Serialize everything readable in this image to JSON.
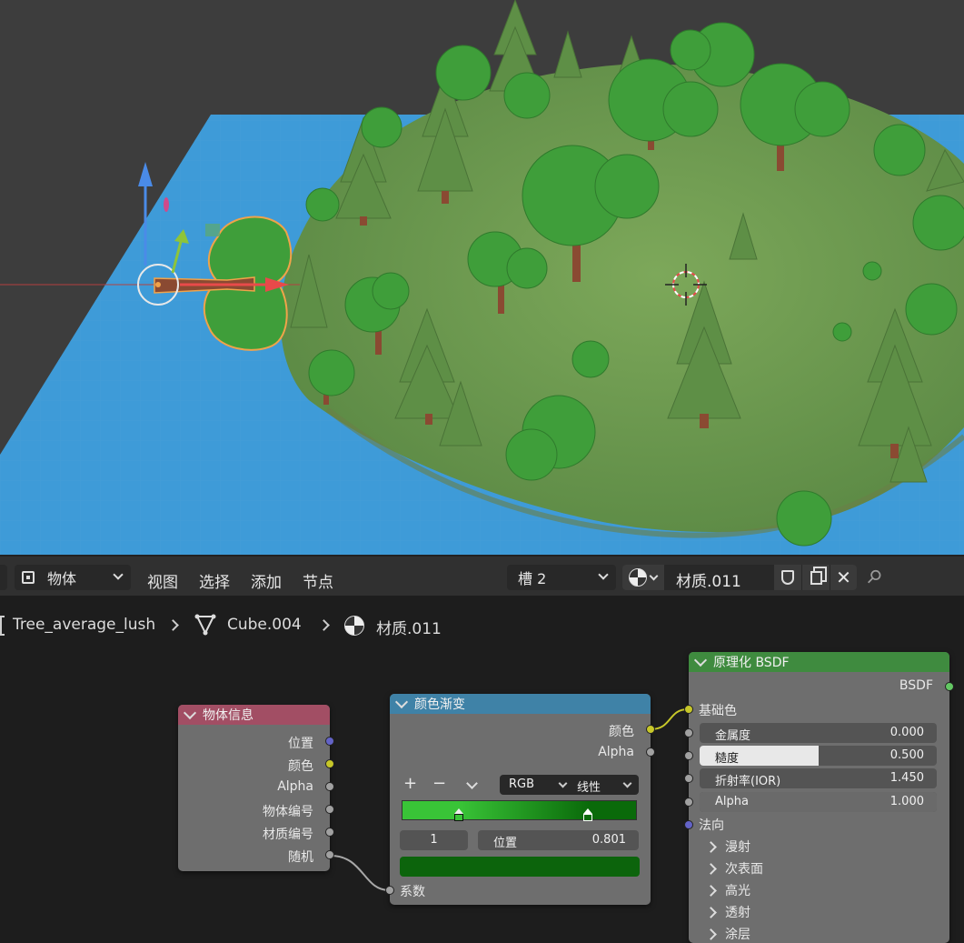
{
  "header": {
    "mode_label": "物体",
    "menu": [
      "视图",
      "选择",
      "添加",
      "节点"
    ],
    "slot_label": "槽 2",
    "material_name": "材质.011"
  },
  "breadcrumb": {
    "object": "Tree_average_lush",
    "mesh": "Cube.004",
    "material": "材质.011"
  },
  "nodes": {
    "object_info": {
      "title": "物体信息",
      "outputs": [
        "位置",
        "颜色",
        "Alpha",
        "物体编号",
        "材质编号",
        "随机"
      ]
    },
    "color_ramp": {
      "title": "颜色渐变",
      "outputs": [
        "颜色",
        "Alpha"
      ],
      "color_mode": "RGB",
      "interpolation": "线性",
      "stop_index": "1",
      "pos_label": "位置",
      "pos_value": "0.801",
      "input": "系数",
      "gradient_left": "#39c437",
      "gradient_right": "#0a6a0a",
      "selected_color": "#0c640c"
    },
    "principled": {
      "title": "原理化 BSDF",
      "output": "BSDF",
      "base_color_label": "基础色",
      "fields": [
        {
          "label": "金属度",
          "value": "0.000",
          "fill": 0.0
        },
        {
          "label": "糙度",
          "value": "0.500",
          "fill": 0.5
        },
        {
          "label": "折射率(IOR)",
          "value": "1.450",
          "fill": 0.0
        },
        {
          "label": "Alpha",
          "value": "1.000",
          "fill": 1.0
        }
      ],
      "normal_label": "法向",
      "panels": [
        "漫射",
        "次表面",
        "高光",
        "透射",
        "涂层"
      ]
    }
  },
  "colors": {
    "header_object_info": "#a24e64",
    "header_color_ramp": "#3f82a7",
    "header_shader": "#3f8b3f",
    "socket_vector": "#6363c7",
    "socket_color": "#c7c729",
    "socket_float": "#a1a1a1",
    "socket_shader": "#63c763"
  }
}
